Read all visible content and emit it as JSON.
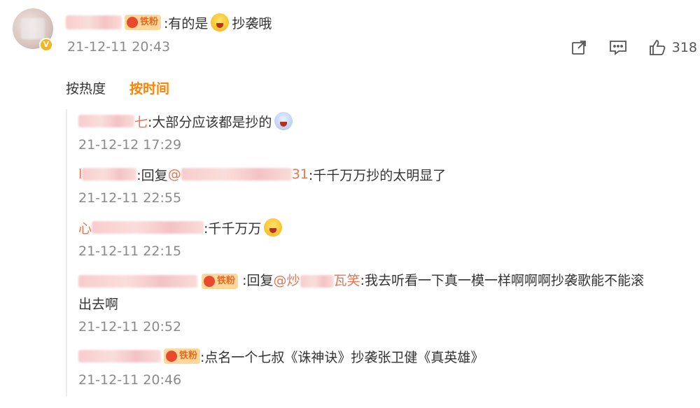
{
  "main_comment": {
    "text": ":有的是",
    "text_after": "抄袭哦",
    "time": "21-12-11 20:43",
    "badge": "铁粉",
    "likes": "318"
  },
  "sort": {
    "hot": "按热度",
    "time": "按时间"
  },
  "replies": [
    {
      "prefix": "七",
      "text": ":大部分应该都是抄的",
      "time": "21-12-12 17:29"
    },
    {
      "prefix": "l",
      "reply_label": ":回复",
      "mention_start": "@",
      "mention_end": "31",
      "text": ":千千万万抄的太明显了",
      "time": "21-12-11 22:55"
    },
    {
      "prefix": "心",
      "text": ":千千万万",
      "time": "21-12-11 22:15"
    },
    {
      "badge": "铁粉",
      "reply_label": ":回复",
      "mention_start": "@炒",
      "mention_end": "瓦笑",
      "text": ":我去听看一下真一模一样啊啊啊抄袭歌能不能滚",
      "text_line2": "出去啊",
      "time": "21-12-11 20:52"
    },
    {
      "badge": "铁粉",
      "text": ":点名一个七叔《诛神诀》抄袭张卫健《真英雄》",
      "time": "21-12-11 20:46"
    }
  ],
  "icons": {
    "share": "share-icon",
    "comment": "comment-icon",
    "like": "thumbs-up-icon"
  },
  "colors": {
    "accent": "#ff8200",
    "mention": "#eb7350",
    "time": "#8a8a8a"
  }
}
